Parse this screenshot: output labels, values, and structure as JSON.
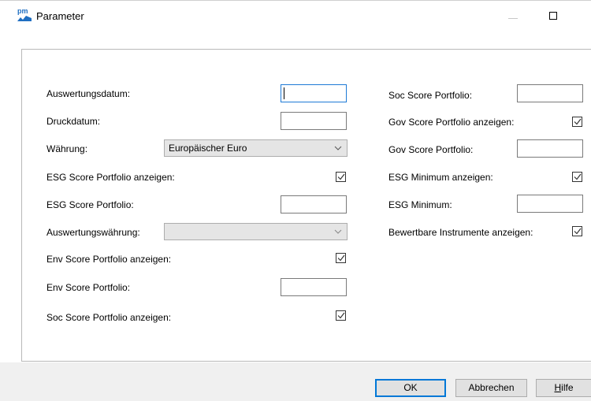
{
  "window": {
    "title": "Parameter",
    "app_icon_text": "pm"
  },
  "form_left": {
    "auswertungsdatum_label": "Auswertungsdatum:",
    "auswertungsdatum_value": "",
    "druckdatum_label": "Druckdatum:",
    "druckdatum_value": "",
    "waehrung_label": "Währung:",
    "waehrung_value": "Europäischer Euro",
    "esg_score_anzeigen_label": "ESG Score Portfolio anzeigen:",
    "esg_score_anzeigen_checked": true,
    "esg_score_label": "ESG Score Portfolio:",
    "esg_score_value": "",
    "auswertungswaehrung_label": "Auswertungswährung:",
    "auswertungswaehrung_value": "",
    "env_score_anzeigen_label": "Env Score Portfolio anzeigen:",
    "env_score_anzeigen_checked": true,
    "env_score_label": "Env Score Portfolio:",
    "env_score_value": "",
    "soc_score_anzeigen_label": "Soc Score Portfolio anzeigen:",
    "soc_score_anzeigen_checked": true
  },
  "form_right": {
    "soc_score_label": "Soc Score Portfolio:",
    "soc_score_value": "",
    "gov_score_anzeigen_label": "Gov Score Portfolio anzeigen:",
    "gov_score_anzeigen_checked": true,
    "gov_score_label": "Gov Score Portfolio:",
    "gov_score_value": "",
    "esg_minimum_anzeigen_label": "ESG Minimum anzeigen:",
    "esg_minimum_anzeigen_checked": true,
    "esg_minimum_label": "ESG Minimum:",
    "esg_minimum_value": "",
    "bewertbare_label": "Bewertbare Instrumente anzeigen:",
    "bewertbare_checked": true
  },
  "buttons": {
    "ok": "OK",
    "abbrechen": "Abbrechen",
    "hilfe_first": "H",
    "hilfe_rest": "ilfe"
  },
  "colors": {
    "focus_border": "#1e7ad6",
    "default_button_border": "#0078d7",
    "footer_bg": "#f0f0f0"
  },
  "icons": {
    "checkbox": "checkmark-icon",
    "dropdown": "chevron-down-icon",
    "minimize": "minimize-icon",
    "maximize": "maximize-icon"
  }
}
